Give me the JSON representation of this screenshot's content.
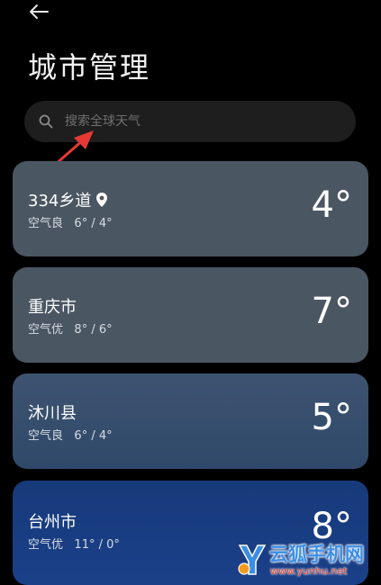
{
  "header": {
    "title": "城市管理"
  },
  "search": {
    "placeholder": "搜索全球天气"
  },
  "cities": [
    {
      "name": "334乡道",
      "aqi": "空气良",
      "range": "6° / 4°",
      "temp": "4°",
      "is_current_location": true
    },
    {
      "name": "重庆市",
      "aqi": "空气优",
      "range": "8° / 6°",
      "temp": "7°"
    },
    {
      "name": "沐川县",
      "aqi": "空气良",
      "range": "6° / 4°",
      "temp": "5°"
    },
    {
      "name": "台州市",
      "aqi": "空气优",
      "range": "11° / 0°",
      "temp": "8°"
    }
  ],
  "icons": {
    "back": "back-arrow-icon",
    "search": "search-icon",
    "location": "location-pin-icon"
  },
  "colors": {
    "background": "#000000",
    "search_bg": "#1e1e1e",
    "card_gray": "#4a5662",
    "card_blue": "#30496a",
    "card_deep_blue": "#1b4089",
    "annotation_red": "#e53935"
  },
  "watermark": {
    "title": "云狐手机网",
    "url": "www.yunhu.net"
  }
}
